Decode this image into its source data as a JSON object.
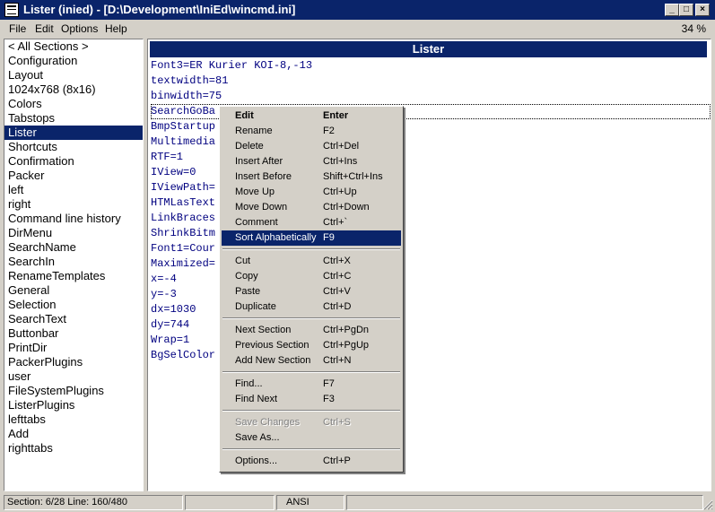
{
  "window": {
    "title": "Lister (inied) - [D:\\Development\\IniEd\\wincmd.ini]",
    "minimize_glyph": "_",
    "maximize_glyph": "□",
    "close_glyph": "×"
  },
  "menubar": {
    "items": [
      "File",
      "Edit",
      "Options",
      "Help"
    ],
    "zoom": "34 %"
  },
  "sections": {
    "items": [
      "< All Sections >",
      "Configuration",
      "Layout",
      "1024x768 (8x16)",
      "Colors",
      "Tabstops",
      "Lister",
      "Shortcuts",
      "Confirmation",
      "Packer",
      "left",
      "right",
      "Command line history",
      "DirMenu",
      "SearchName",
      "SearchIn",
      "RenameTemplates",
      "General",
      "Selection",
      "SearchText",
      "Buttonbar",
      "PrintDir",
      "PackerPlugins",
      "user",
      "FileSystemPlugins",
      "ListerPlugins",
      "lefttabs",
      "Add",
      "righttabs"
    ],
    "selected_index": 6
  },
  "editor": {
    "header": "Lister",
    "lines": [
      "Font3=ER Kurier KOI-8,-13",
      "textwidth=81",
      "binwidth=75",
      "SearchGoBa",
      "BmpStartup",
      "Multimedia",
      "RTF=1",
      "IView=0",
      "IViewPath=",
      "HTMLasText",
      "LinkBraces",
      "ShrinkBitm",
      "Font1=Cour",
      "Maximized=",
      "x=-4",
      "y=-3",
      "dx=1030",
      "dy=744",
      "Wrap=1",
      "BgSelColor"
    ],
    "focused_index": 3
  },
  "context_menu": {
    "groups": [
      [
        {
          "label": "Edit",
          "shortcut": "Enter",
          "bold": true
        },
        {
          "label": "Rename",
          "shortcut": "F2"
        },
        {
          "label": "Delete",
          "shortcut": "Ctrl+Del"
        },
        {
          "label": "Insert After",
          "shortcut": "Ctrl+Ins"
        },
        {
          "label": "Insert Before",
          "shortcut": "Shift+Ctrl+Ins"
        },
        {
          "label": "Move Up",
          "shortcut": "Ctrl+Up"
        },
        {
          "label": "Move Down",
          "shortcut": "Ctrl+Down"
        },
        {
          "label": "Comment",
          "shortcut": "Ctrl+`"
        },
        {
          "label": "Sort Alphabetically",
          "shortcut": "F9",
          "highlighted": true
        }
      ],
      [
        {
          "label": "Cut",
          "shortcut": "Ctrl+X"
        },
        {
          "label": "Copy",
          "shortcut": "Ctrl+C"
        },
        {
          "label": "Paste",
          "shortcut": "Ctrl+V"
        },
        {
          "label": "Duplicate",
          "shortcut": "Ctrl+D"
        }
      ],
      [
        {
          "label": "Next Section",
          "shortcut": "Ctrl+PgDn"
        },
        {
          "label": "Previous Section",
          "shortcut": "Ctrl+PgUp"
        },
        {
          "label": "Add New Section",
          "shortcut": "Ctrl+N"
        }
      ],
      [
        {
          "label": "Find...",
          "shortcut": "F7"
        },
        {
          "label": "Find Next",
          "shortcut": "F3"
        }
      ],
      [
        {
          "label": "Save Changes",
          "shortcut": "Ctrl+S",
          "disabled": true
        },
        {
          "label": "Save As...",
          "shortcut": ""
        }
      ],
      [
        {
          "label": "Options...",
          "shortcut": "Ctrl+P"
        }
      ]
    ]
  },
  "statusbar": {
    "position": "Section: 6/28  Line: 160/480",
    "empty1": "",
    "encoding": "ANSI",
    "empty2": ""
  }
}
